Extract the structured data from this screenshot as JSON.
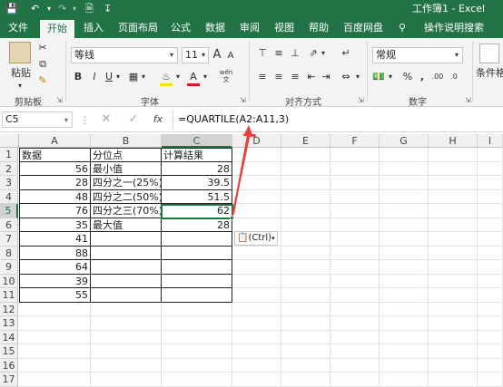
{
  "titlebar": {
    "doc_title": "工作簿1 - Excel"
  },
  "tabs": [
    "文件",
    "开始",
    "插入",
    "页面布局",
    "公式",
    "数据",
    "审阅",
    "视图",
    "帮助",
    "百度网盘",
    "操作说明搜索"
  ],
  "ribbon": {
    "paste_label": "粘贴",
    "clipboard_label": "剪贴板",
    "font_name": "等线",
    "font_size": "11",
    "font_label": "字体",
    "align_label": "对齐方式",
    "number_format": "常规",
    "number_label": "数字",
    "cond_format_label": "条件格",
    "bold": "B",
    "italic": "I",
    "underline": "U",
    "grow_font": "A",
    "shrink_font": "A",
    "wen": "wén",
    "percent": "%",
    "comma": ","
  },
  "formula_bar": {
    "name_box": "C5",
    "fx": "fx",
    "formula": "=QUARTILE(A2:A11,3)"
  },
  "columns": [
    "A",
    "B",
    "C",
    "D",
    "E",
    "F",
    "G",
    "H",
    "I"
  ],
  "rows": [
    "1",
    "2",
    "3",
    "4",
    "5",
    "6",
    "7",
    "8",
    "9",
    "10",
    "11",
    "12",
    "13",
    "14",
    "15",
    "16",
    "17"
  ],
  "cells": {
    "A": [
      "数据",
      "56",
      "28",
      "48",
      "76",
      "35",
      "41",
      "88",
      "64",
      "39",
      "55"
    ],
    "B": [
      "分位点",
      "最小值",
      "四分之一(25%)",
      "四分之二(50%)",
      "四分之三(70%)",
      "最大值"
    ],
    "C": [
      "计算结果",
      "28",
      "39.5",
      "51.5",
      "62",
      "28"
    ]
  },
  "paste_options": {
    "label": "(Ctrl)"
  },
  "colors": {
    "excel_green": "#217346",
    "arrow_red": "#e8413b"
  }
}
